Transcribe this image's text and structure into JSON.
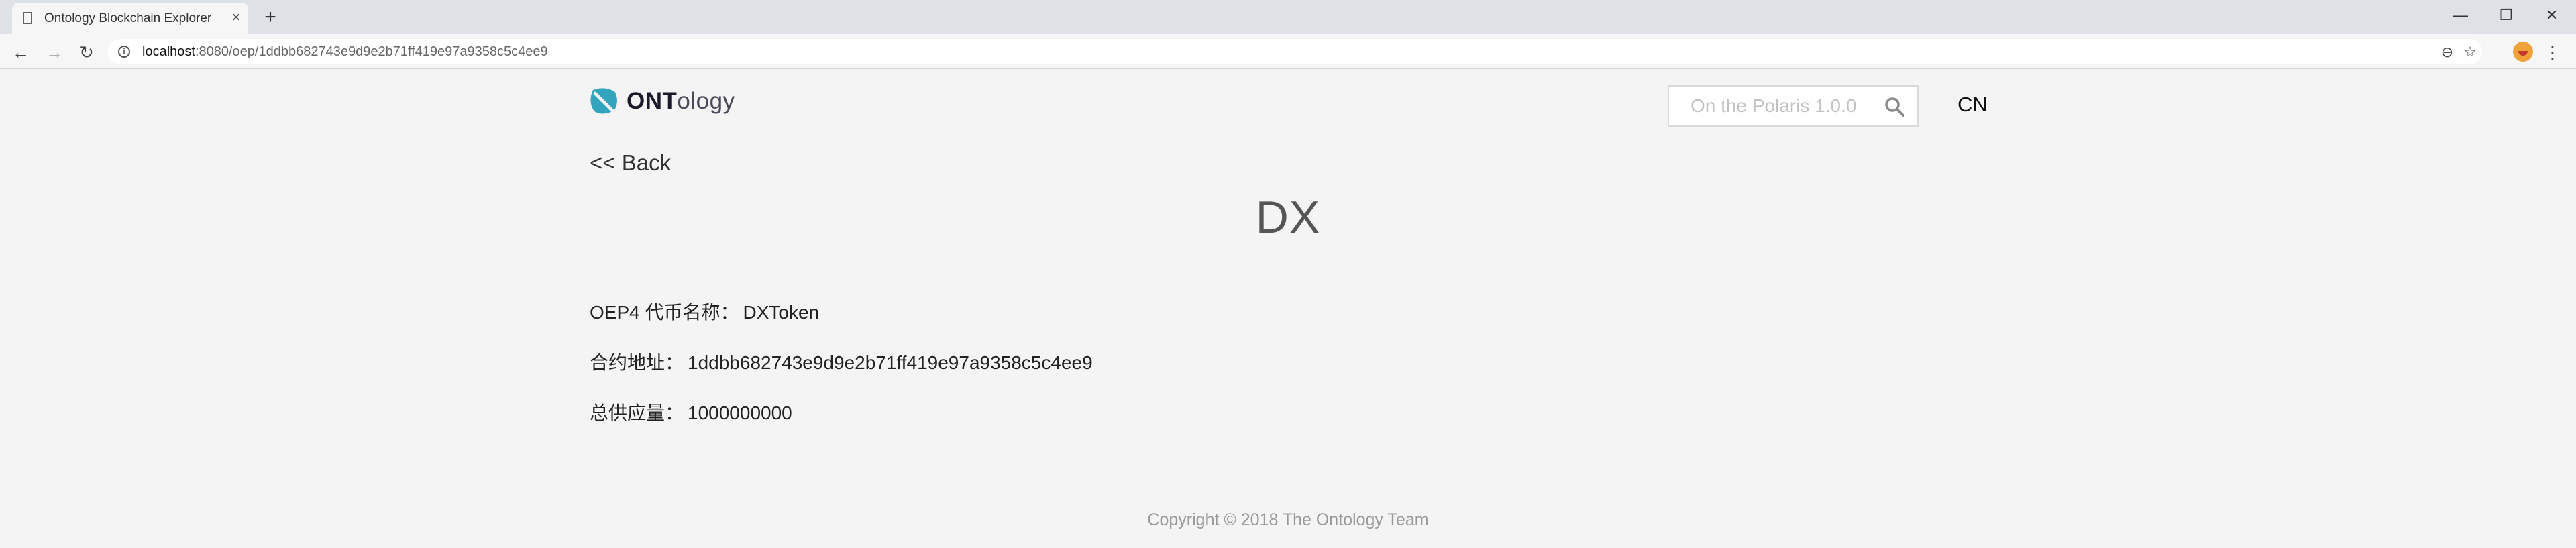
{
  "browser": {
    "tab_title": "Ontology Blockchain Explorer",
    "tab_close": "×",
    "new_tab": "+",
    "window_minimize": "—",
    "window_restore": "❐",
    "window_close": "✕",
    "back_arrow": "←",
    "forward_arrow": "→",
    "reload": "↻",
    "url_host": "localhost",
    "url_path": ":8080/oep/1ddbb682743e9d9e2b71ff419e97a9358c5c4ee9",
    "zoom_icon": "⊖",
    "star_icon": "☆",
    "menu_icon": "⋮"
  },
  "header": {
    "logo_bold": "ONT",
    "logo_light": "ology",
    "search_placeholder": "On the Polaris 1.0.0",
    "language": "CN",
    "brand_color": "#32a4be"
  },
  "page": {
    "back_label": "<< Back",
    "token_symbol": "DX",
    "rows": [
      {
        "label": "OEP4 代币名称：",
        "value": "DXToken"
      },
      {
        "label": "合约地址：",
        "value": "1ddbb682743e9d9e2b71ff419e97a9358c5c4ee9"
      },
      {
        "label": "总供应量：",
        "value": "1000000000"
      }
    ]
  },
  "footer": {
    "copyright": "Copyright © 2018 The Ontology Team"
  }
}
